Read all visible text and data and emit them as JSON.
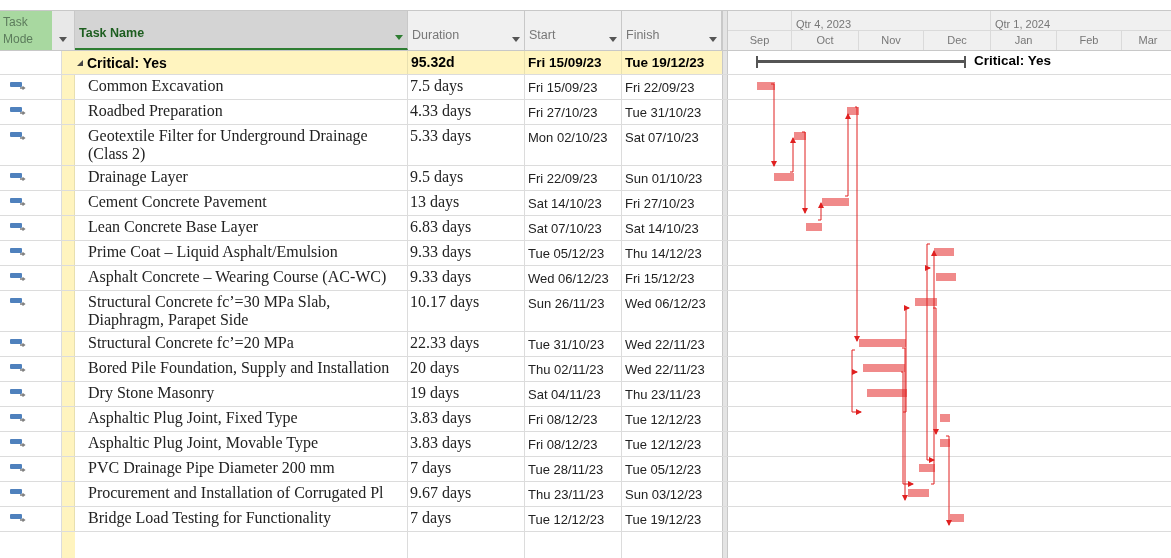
{
  "columns": {
    "task_mode": "Task Mode",
    "task_name": "Task Name",
    "duration": "Duration",
    "start": "Start",
    "finish": "Finish"
  },
  "timescale": {
    "quarters": [
      "Qtr 4, 2023",
      "Qtr 1, 2024"
    ],
    "months": [
      "Sep",
      "Oct",
      "Nov",
      "Dec",
      "Jan",
      "Feb",
      "Mar"
    ]
  },
  "group": {
    "name": "Critical: Yes",
    "duration": "95.32d",
    "start": "Fri 15/09/23",
    "finish": "Tue 19/12/23",
    "expanded": true,
    "gantt_label": "Critical: Yes"
  },
  "tasks": [
    {
      "name": "Common Excavation",
      "duration": "7.5 days",
      "start": "Fri 15/09/23",
      "finish": "Fri 22/09/23"
    },
    {
      "name": "Roadbed Preparation",
      "duration": "4.33 days",
      "start": "Fri 27/10/23",
      "finish": "Tue 31/10/23"
    },
    {
      "name": "Geotextile Filter for Underground Drainage (Class 2)",
      "duration": "5.33 days",
      "start": "Mon 02/10/23",
      "finish": "Sat 07/10/23"
    },
    {
      "name": "Drainage Layer",
      "duration": "9.5 days",
      "start": "Fri 22/09/23",
      "finish": "Sun 01/10/23"
    },
    {
      "name": "Cement Concrete Pavement",
      "duration": "13 days",
      "start": "Sat 14/10/23",
      "finish": "Fri 27/10/23"
    },
    {
      "name": "Lean Concrete Base Layer",
      "duration": "6.83 days",
      "start": "Sat 07/10/23",
      "finish": "Sat 14/10/23"
    },
    {
      "name": "Prime Coat – Liquid Asphalt/Emulsion",
      "duration": "9.33 days",
      "start": "Tue 05/12/23",
      "finish": "Thu 14/12/23"
    },
    {
      "name": "Asphalt Concrete – Wearing Course (AC-WC)",
      "duration": "9.33 days",
      "start": "Wed 06/12/23",
      "finish": "Fri 15/12/23"
    },
    {
      "name": "Structural Concrete fc’=30 MPa Slab, Diaphragm, Parapet Side",
      "duration": "10.17 days",
      "start": "Sun 26/11/23",
      "finish": "Wed 06/12/23"
    },
    {
      "name": "Structural Concrete fc’=20 MPa",
      "duration": "22.33 days",
      "start": "Tue 31/10/23",
      "finish": "Wed 22/11/23"
    },
    {
      "name": "Bored Pile Foundation, Supply and Installation",
      "duration": "20 days",
      "start": "Thu 02/11/23",
      "finish": "Wed 22/11/23"
    },
    {
      "name": "Dry Stone Masonry",
      "duration": "19 days",
      "start": "Sat 04/11/23",
      "finish": "Thu 23/11/23"
    },
    {
      "name": "Asphaltic Plug Joint, Fixed Type",
      "duration": "3.83 days",
      "start": "Fri 08/12/23",
      "finish": "Tue 12/12/23"
    },
    {
      "name": "Asphaltic Plug Joint, Movable Type",
      "duration": "3.83 days",
      "start": "Fri 08/12/23",
      "finish": "Tue 12/12/23"
    },
    {
      "name": "PVC Drainage Pipe Diameter 200 mm",
      "duration": "7 days",
      "start": "Tue 28/11/23",
      "finish": "Tue 05/12/23"
    },
    {
      "name": "Procurement and Installation of Corrugated Pl",
      "duration": "9.67 days",
      "start": "Thu 23/11/23",
      "finish": "Sun 03/12/23"
    },
    {
      "name": "Bridge Load Testing for Functionality",
      "duration": "7 days",
      "start": "Tue 12/12/23",
      "finish": "Tue 19/12/23"
    }
  ]
}
